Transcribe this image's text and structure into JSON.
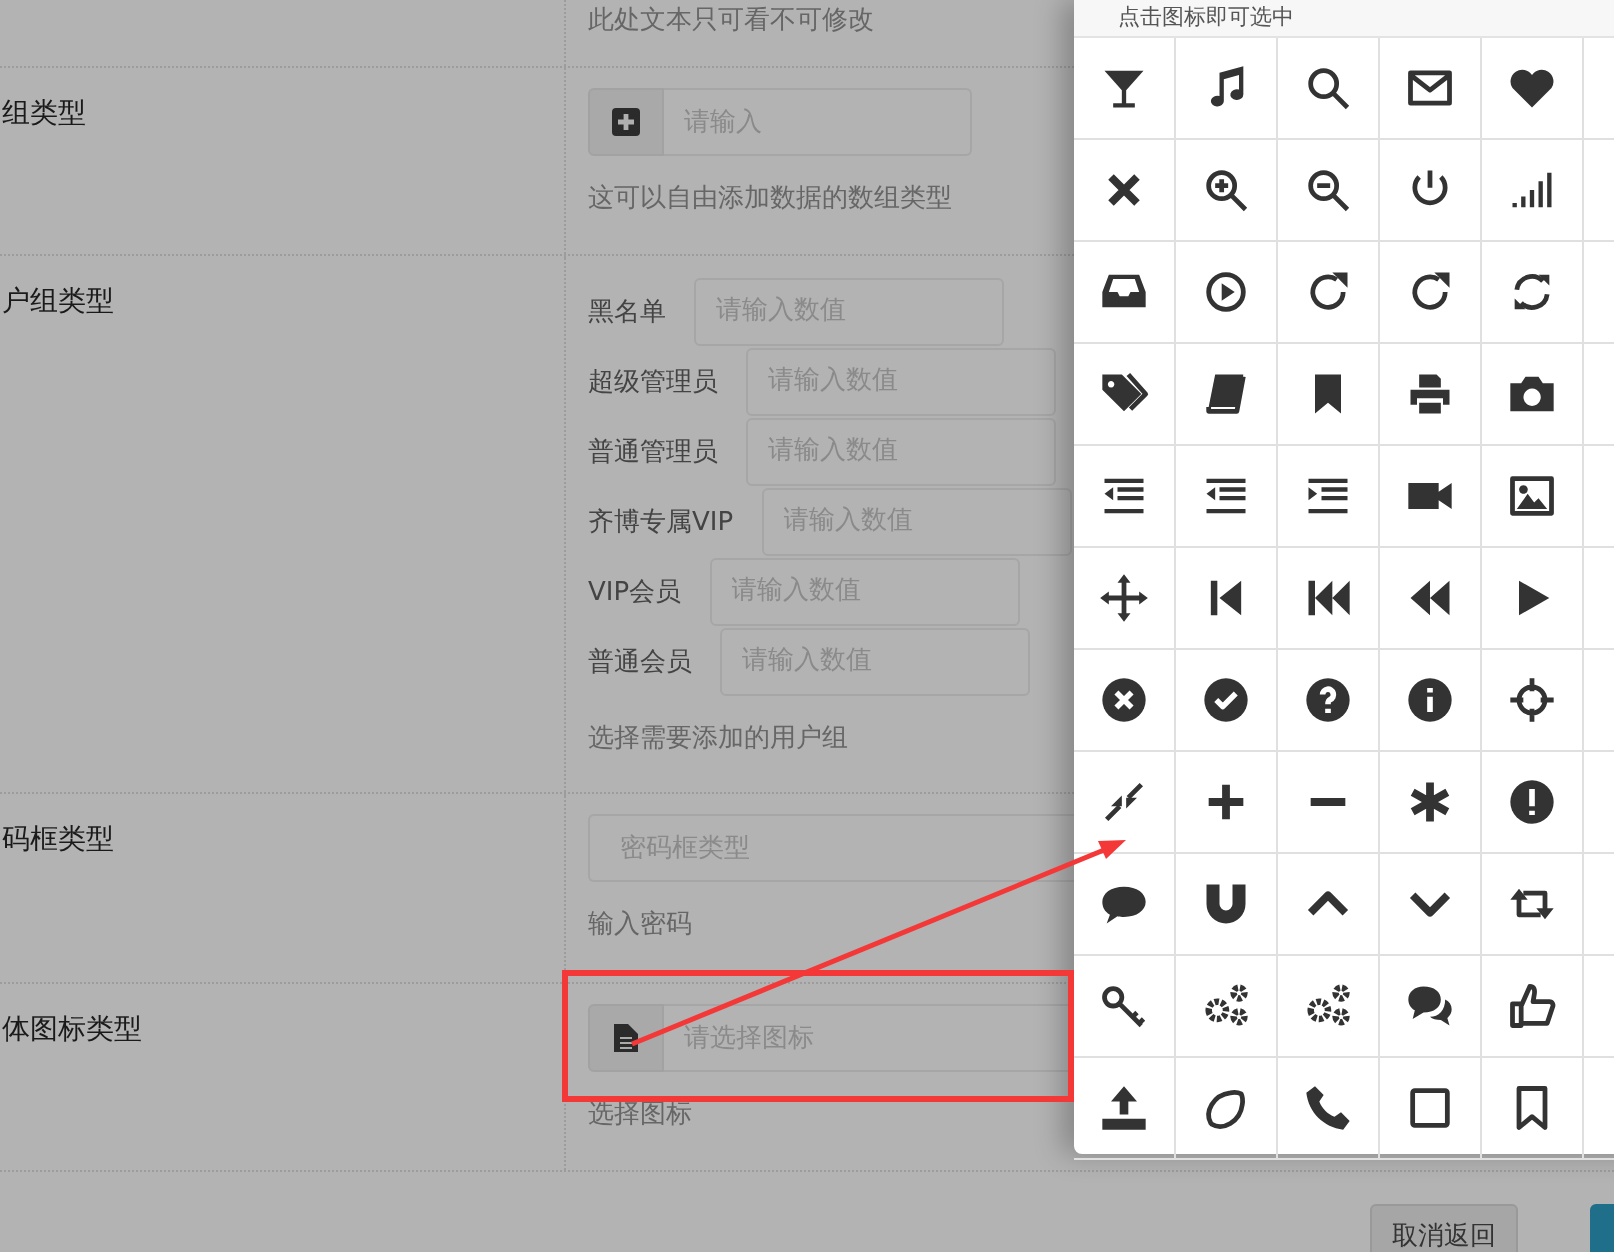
{
  "top_note": "此处文本只可看不可修改",
  "rows": [
    {
      "kind": "array",
      "label": "组类型",
      "placeholder": "请输入",
      "help": "这可以自由添加数据的数组类型"
    },
    {
      "kind": "usergroup",
      "label": "户组类型",
      "groups": [
        {
          "label": "黑名单",
          "placeholder": "请输入数值"
        },
        {
          "label": "超级管理员",
          "placeholder": "请输入数值"
        },
        {
          "label": "普通管理员",
          "placeholder": "请输入数值"
        },
        {
          "label": "齐博专属VIP",
          "placeholder": "请输入数值"
        },
        {
          "label": "VIP会员",
          "placeholder": "请输入数值"
        },
        {
          "label": "普通会员",
          "placeholder": "请输入数值"
        }
      ],
      "help": "选择需要添加的用户组"
    },
    {
      "kind": "password",
      "label": "码框类型",
      "placeholder": "密码框类型",
      "help": "输入密码"
    },
    {
      "kind": "iconpicker",
      "label": "体图标类型",
      "placeholder": "请选择图标",
      "help": "选择图标"
    }
  ],
  "icon_popup": {
    "hint": "点击图标即可选中"
  },
  "buttons": [
    {
      "kind": "default",
      "label": "取消返回"
    },
    {
      "kind": "primary"
    }
  ]
}
